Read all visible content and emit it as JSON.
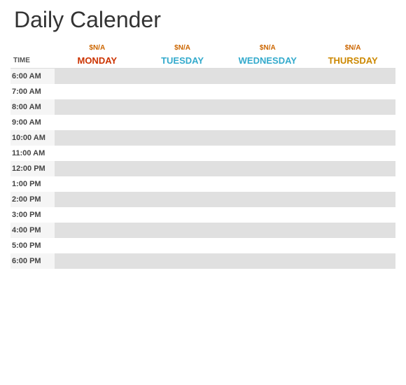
{
  "title": "Daily Calender",
  "columns": {
    "time_label": "TIME",
    "monday": {
      "date": "$N/A",
      "label": "MONDAY"
    },
    "tuesday": {
      "date": "$N/A",
      "label": "TUESDAY"
    },
    "wednesday": {
      "date": "$N/A",
      "label": "WEDNESDAY"
    },
    "thursday": {
      "date": "$N/A",
      "label": "THURSDAY"
    }
  },
  "time_slots": [
    "6:00 AM",
    "7:00 AM",
    "8:00 AM",
    "9:00 AM",
    "10:00 AM",
    "11:00 AM",
    "12:00 PM",
    "1:00 PM",
    "2:00 PM",
    "3:00 PM",
    "4:00 PM",
    "5:00 PM",
    "6:00 PM"
  ]
}
